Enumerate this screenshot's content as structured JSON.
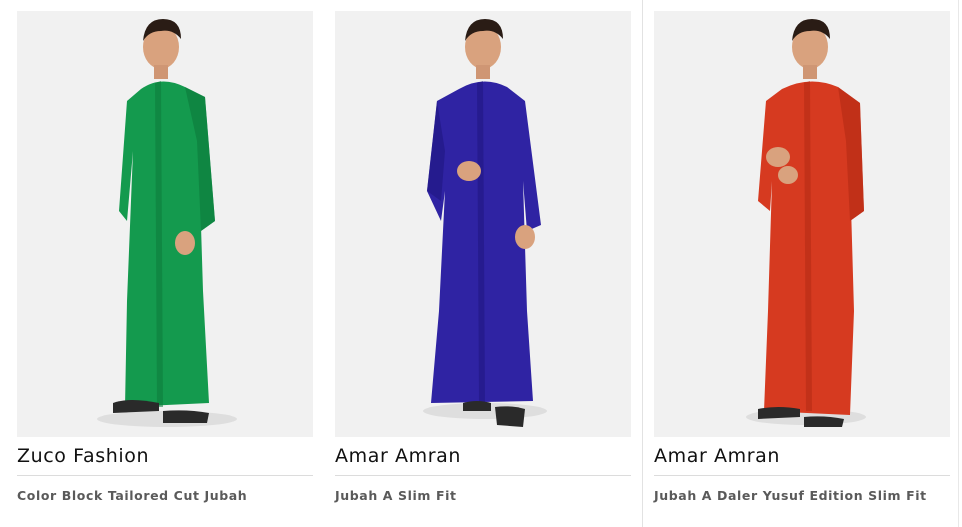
{
  "products": [
    {
      "brand": "Zuco Fashion",
      "name": "Color Block Tailored Cut Jubah",
      "garment_color": "#149a4e",
      "garment_shade": "#0c7a3b"
    },
    {
      "brand": "Amar Amran",
      "name": "Jubah A Slim Fit",
      "garment_color": "#2f23a3",
      "garment_shade": "#1f1680"
    },
    {
      "brand": "Amar Amran",
      "name": "Jubah A Daler Yusuf Edition Slim Fit",
      "garment_color": "#d63a20",
      "garment_shade": "#b22914"
    }
  ]
}
